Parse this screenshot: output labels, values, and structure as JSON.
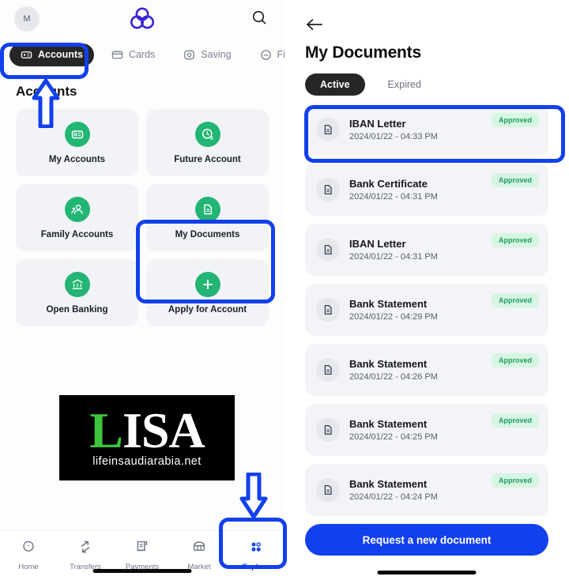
{
  "colors": {
    "accent_blue": "#1240ec",
    "green": "#22b573",
    "badge_bg": "#d6f5e2",
    "badge_text": "#1f9d63",
    "dark_pill": "#262626",
    "tile_bg": "#f2f3f6",
    "logo_purple": "#3823d6"
  },
  "left_panel": {
    "header": {
      "avatar_initial": "M",
      "logo_name": "bank-logo",
      "search_name": "search-icon"
    },
    "tabs": [
      {
        "label": "Accounts",
        "icon": "account-card-icon",
        "active": true
      },
      {
        "label": "Cards",
        "icon": "credit-card-icon",
        "active": false
      },
      {
        "label": "Saving",
        "icon": "savings-icon",
        "active": false
      },
      {
        "label": "Finan",
        "icon": "finance-icon",
        "active": false
      }
    ],
    "page_title": "Accounts",
    "tiles": [
      {
        "label": "My Accounts",
        "icon": "id-card-icon"
      },
      {
        "label": "Future Account",
        "icon": "clock-dollar-icon"
      },
      {
        "label": "Family Accounts",
        "icon": "family-person-icon"
      },
      {
        "label": "My Documents",
        "icon": "document-icon",
        "highlighted": true
      },
      {
        "label": "Open Banking",
        "icon": "bank-building-icon"
      },
      {
        "label": "Apply for Account",
        "icon": "plus-icon"
      }
    ],
    "watermark": {
      "word_first_letter": "L",
      "word_rest": "ISA",
      "url": "lifeinsaudiarabia.net"
    },
    "bottom_nav": [
      {
        "label": "Home",
        "icon": "home-icon",
        "active": false
      },
      {
        "label": "Transfers",
        "icon": "transfers-arrows-icon",
        "active": false
      },
      {
        "label": "Payments",
        "icon": "receipt-icon",
        "active": false
      },
      {
        "label": "Market",
        "icon": "market-basket-icon",
        "active": false
      },
      {
        "label": "Explore",
        "icon": "explore-dots-icon",
        "active": true
      }
    ]
  },
  "right_panel": {
    "back_icon": "back-arrow-icon",
    "title": "My Documents",
    "segments": [
      {
        "label": "Active",
        "active": true
      },
      {
        "label": "Expired",
        "active": false
      }
    ],
    "documents": [
      {
        "name": "IBAN Letter",
        "date": "2024/01/22 - 04:33 PM",
        "status": "Approved",
        "highlighted": true
      },
      {
        "name": "Bank Certificate",
        "date": "2024/01/22 - 04:31 PM",
        "status": "Approved",
        "highlighted": false
      },
      {
        "name": "IBAN Letter",
        "date": "2024/01/22 - 04:31 PM",
        "status": "Approved",
        "highlighted": false
      },
      {
        "name": "Bank Statement",
        "date": "2024/01/22 - 04:29 PM",
        "status": "Approved",
        "highlighted": false
      },
      {
        "name": "Bank Statement",
        "date": "2024/01/22 - 04:26 PM",
        "status": "Approved",
        "highlighted": false
      },
      {
        "name": "Bank Statement",
        "date": "2024/01/22 - 04:25 PM",
        "status": "Approved",
        "highlighted": false
      },
      {
        "name": "Bank Statement",
        "date": "2024/01/22 - 04:24 PM",
        "status": "Approved",
        "highlighted": false
      }
    ],
    "cta_label": "Request a new document"
  }
}
